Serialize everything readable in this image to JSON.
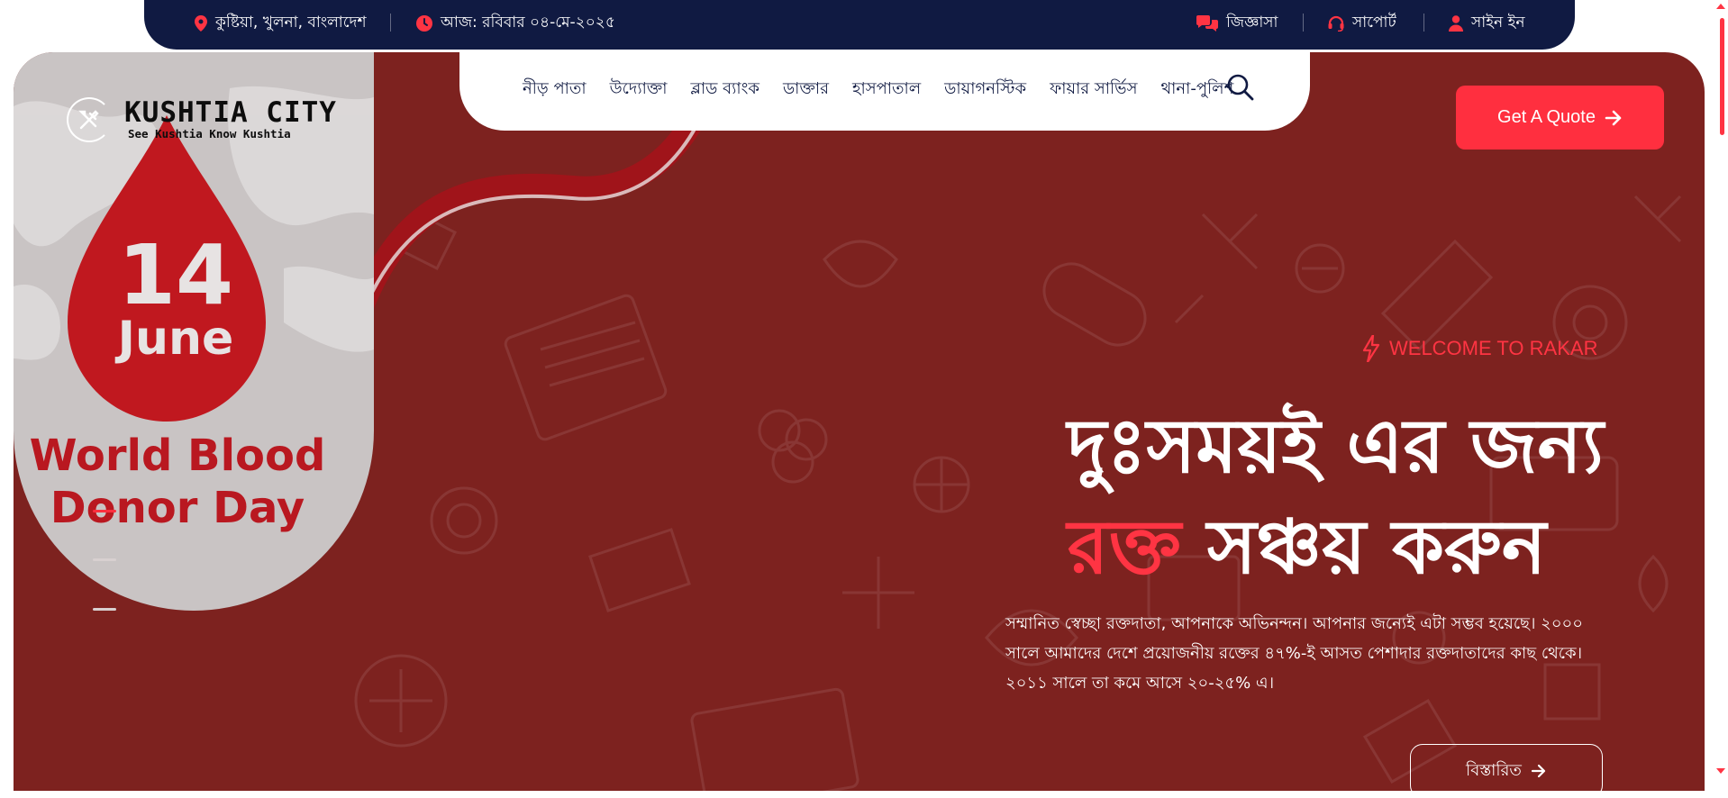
{
  "topbar": {
    "location": "কুষ্টিয়া, খুলনা, বাংলাদেশ",
    "date": "আজ: রবিবার ০৪-মে-২০২৫",
    "inquiry": "জিজ্ঞাসা",
    "support": "সাপোর্ট",
    "signin": "সাইন ইন"
  },
  "logo": {
    "title": "KUSHTIA CITY",
    "subtitle": "See Kushtia Know Kushtia"
  },
  "nav": {
    "items": [
      "নীড় পাতা",
      "উদ্যোক্তা",
      "ব্লাড ব্যাংক",
      "ডাক্তার",
      "হাসপাতাল",
      "ডায়াগনস্টিক",
      "ফায়ার সার্ভিস",
      "থানা-পুলিশ"
    ]
  },
  "quote_button": "Get A Quote",
  "slide_image": {
    "day": "14",
    "month": "June",
    "line1": "World Blood",
    "line2": "Donor Day"
  },
  "hero": {
    "welcome": "WELCOME TO RAKAR",
    "headline_line1": "দুঃসময়ই এর জন্য",
    "headline_red": "রক্ত",
    "headline_rest": " সঞ্চয় করুন",
    "description": "সম্মানিত স্বেচ্ছা রক্তদাতা, আপনাকে অভিনন্দন। আপনার জন্যেই এটা সম্ভব হয়েছে। ২০০০ সালে আমাদের দেশে প্রয়োজনীয় রক্তের ৪৭%-ই আসত পেশাদার রক্তদাতাদের কাছ থেকে। ২০১১ সালে তা কমে আসে ২০-২৫% এ।",
    "more_button": "বিস্তারিত"
  },
  "slider": {
    "count": 3,
    "active": 1
  },
  "colors": {
    "navy": "#101a42",
    "accent_red": "#ff2f3f",
    "hero_bg": "#7d221f"
  },
  "icons": {
    "location": "map-pin-icon",
    "date": "clock-icon",
    "inquiry": "chat-icon",
    "support": "headset-icon",
    "signin": "user-icon",
    "search": "search-icon",
    "welcome": "bolt-icon",
    "arrow": "arrow-right-icon"
  }
}
